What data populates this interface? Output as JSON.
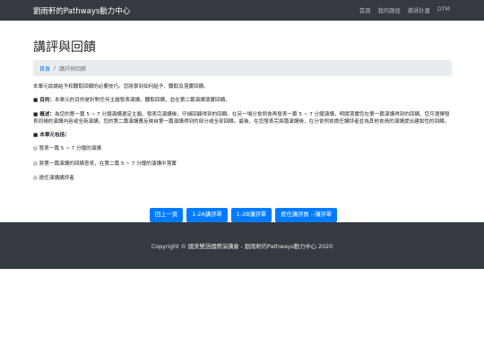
{
  "navbar": {
    "brand": "劉雨軒的Pathways動力中心",
    "links": [
      "首頁",
      "我的路徑",
      "導師計畫",
      "DTM"
    ]
  },
  "page_title": "講評與回饋",
  "breadcrumb": {
    "home": "首頁",
    "separator": "/",
    "current": "講評與回饋"
  },
  "content": {
    "intro": "本單元談論給予和聽取回饋的必要技巧。您將學到如何給予、聽取及落實回饋。",
    "goal_label": "■ 目的：",
    "goal_text": "本單元的目的是針對任何主題發表演講、聽取回饋，並在第二篇演講落實回饋。",
    "overview_label": "■ 概述：",
    "overview_text": "為您的第一篇 5 ~ 7 分鐘演講選定主題。發表完演講後，仔細回顧得到的回饋。在另一場分會例會再發表一篇 5 ~ 7 分鐘演講，明閱落實您在第一篇演講得到的回饋。您可選擇發表同樣的演講內容或全新演講。您的第二篇演講應反映自第一篇演講得到的部分或全部回饋。最後，在您發表完兩篇演講後，在分會例會擔任講評者並為其他會員的演講提出建設性的回饋。",
    "includes_label": "■ 本單元包括：",
    "items": [
      "◎ 發表一篇 5 ~ 7 分鐘的演講",
      "◎ 將第一篇演講的回饋意見，在第二篇 5 ~ 7 分鐘的演講中落實",
      "◎ 擔任演講講評者"
    ]
  },
  "buttons": {
    "back": "回上一頁",
    "speech_2a": "1-2A講評單",
    "speech_2b": "1-2B講評單",
    "evaluator": "擔任講評員 --講評單"
  },
  "footer": {
    "text": "Copyright © 國美雙語國際演講會 - 劉雨軒的Pathways動力中心 2020"
  },
  "colors": {
    "navbar": "#343a40",
    "primary": "#007bff",
    "breadcrumb_bg": "#e9ecef"
  }
}
